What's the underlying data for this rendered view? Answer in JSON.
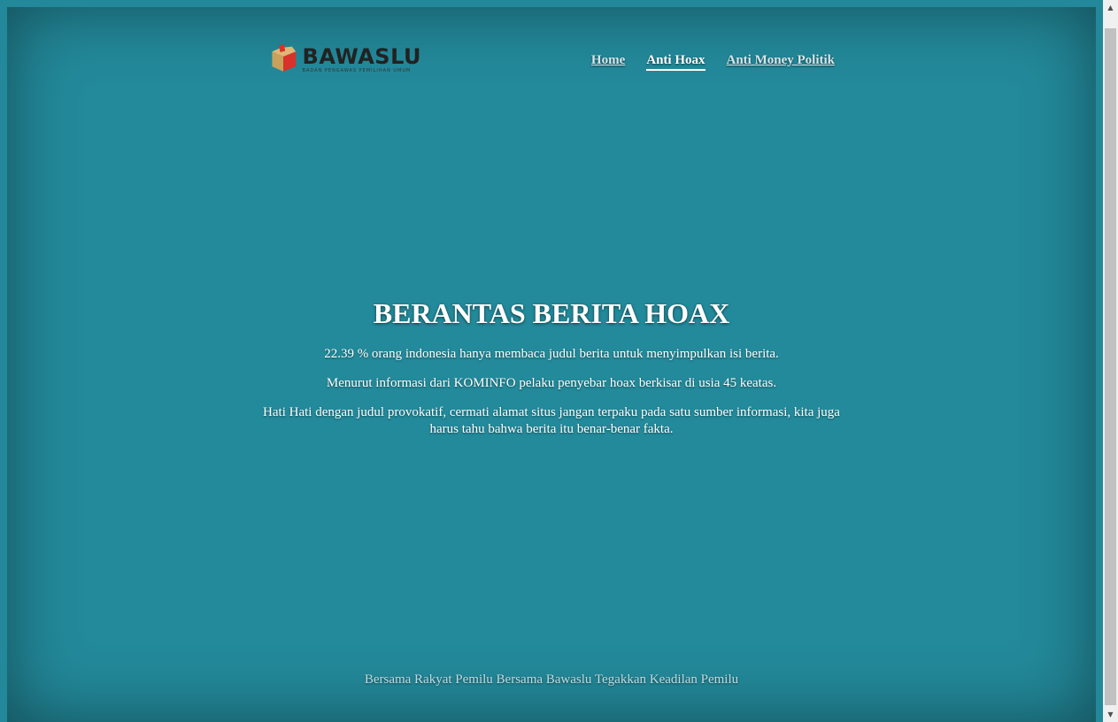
{
  "header": {
    "logo_text": "BAWASLU",
    "logo_subtext": "BADAN PENGAWAS PEMILIHAN UMUM",
    "nav": [
      {
        "label": "Home",
        "active": false
      },
      {
        "label": "Anti Hoax",
        "active": true
      },
      {
        "label": "Anti Money Politik",
        "active": false
      }
    ]
  },
  "main": {
    "title": "BERANTAS BERITA HOAX",
    "paragraphs": [
      "22.39 % orang indonesia hanya membaca judul berita untuk menyimpulkan isi berita.",
      "Menurut informasi dari KOMINFO pelaku penyebar hoax berkisar di usia 45 keatas.",
      "Hati Hati dengan judul provokatif, cermati alamat situs jangan terpaku pada satu sumber informasi, kita juga harus tahu bahwa berita itu benar-benar fakta."
    ]
  },
  "footer": {
    "text": "Bersama Rakyat Pemilu Bersama Bawaslu Tegakkan Keadilan Pemilu"
  },
  "scrollbar": {
    "up_icon": "triangle-up-icon",
    "down_icon": "triangle-down-icon"
  },
  "colors": {
    "background": "#238a9b",
    "logo_red": "#d9322a",
    "logo_gold": "#c9a15a"
  }
}
